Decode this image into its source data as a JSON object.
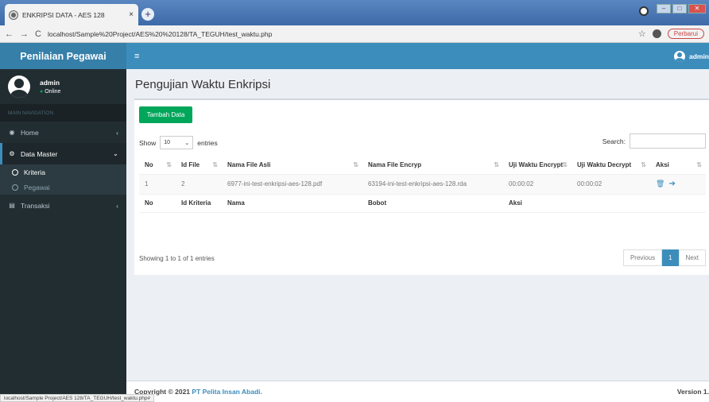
{
  "browser": {
    "tab_title": "ENKRIPSI DATA - AES 128",
    "tab_close": "×",
    "new_tab": "+",
    "url": "localhost/Sample%20Project/AES%20%20128/TA_TEGUH/test_waktu.php",
    "update_label": "Perbarui",
    "status_url": "localhost/Sample Project/AES 128/TA_TEGUH/test_waktu.php#"
  },
  "header": {
    "brand": "Penilaian Pegawai",
    "toggle": "≡",
    "user": "admin"
  },
  "sidebar": {
    "user_name": "admin",
    "user_status": "Online",
    "nav_heading": "MAIN NAVIGATION",
    "items": [
      {
        "label": "Home",
        "icon": "dashboard-icon",
        "caret": "‹"
      },
      {
        "label": "Data Master",
        "icon": "cogs-icon",
        "caret": "⌄"
      },
      {
        "label": "Transaksi",
        "icon": "list-icon",
        "caret": "‹"
      }
    ],
    "sub_items": [
      {
        "label": "Kriteria"
      },
      {
        "label": "Pegawai"
      }
    ]
  },
  "page": {
    "title": "Pengujian Waktu Enkripsi"
  },
  "box": {
    "add_button": "Tambah Data",
    "show_label": "Show",
    "entries_value": "10",
    "entries_label": "entries",
    "search_label": "Search:",
    "columns": [
      "No",
      "Id File",
      "Nama File Asli",
      "Nama File Encryp",
      "Uji Waktu Encrypt",
      "Uji Waktu Decrypt",
      "Aksi"
    ],
    "rows": [
      [
        "1",
        "2",
        "6977-ini-test-enkripsi-aes-128.pdf",
        "63194-ini-test-enkripsi-aes-128.rda",
        "00:00:02",
        "00:00:02"
      ]
    ],
    "footer_columns": [
      "No",
      "Id Kriteria",
      "Nama",
      "Bobot",
      "Aksi"
    ],
    "info": "Showing 1 to 1 of 1 entries",
    "pager": {
      "prev": "Previous",
      "page": "1",
      "next": "Next"
    }
  },
  "footer": {
    "copyright": "Copyright © 2021",
    "company": "PT Pelita Insan Abadi.",
    "version": "Version 1."
  },
  "colors": {
    "primary": "#3c8dbc",
    "success": "#00a65a",
    "sidebar": "#222d32"
  }
}
